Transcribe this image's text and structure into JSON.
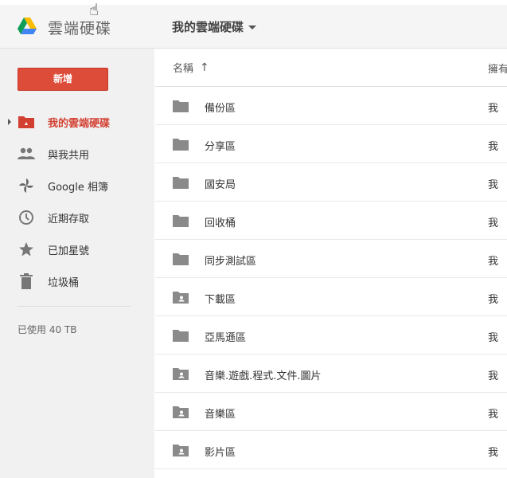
{
  "app": {
    "title": "雲端硬碟"
  },
  "breadcrumb": {
    "current": "我的雲端硬碟"
  },
  "sidebar": {
    "new_button": "新增",
    "items": [
      {
        "label": "我的雲端硬碟",
        "icon": "my-drive-icon",
        "active": true
      },
      {
        "label": "與我共用",
        "icon": "shared-people-icon",
        "active": false
      },
      {
        "label": "Google 相簿",
        "icon": "google-photos-icon",
        "active": false
      },
      {
        "label": "近期存取",
        "icon": "clock-icon",
        "active": false
      },
      {
        "label": "已加星號",
        "icon": "star-icon",
        "active": false
      },
      {
        "label": "垃圾桶",
        "icon": "trash-icon",
        "active": false
      }
    ],
    "storage": "已使用 40 TB"
  },
  "list": {
    "columns": {
      "name": "名稱",
      "owner": "擁有"
    },
    "sort_icon": "arrow-up-icon",
    "rows": [
      {
        "name": "備份區",
        "owner": "我",
        "type": "folder"
      },
      {
        "name": "分享區",
        "owner": "我",
        "type": "folder"
      },
      {
        "name": "國安局",
        "owner": "我",
        "type": "folder"
      },
      {
        "name": "回收桶",
        "owner": "我",
        "type": "folder"
      },
      {
        "name": "同步測試區",
        "owner": "我",
        "type": "folder"
      },
      {
        "name": "下載區",
        "owner": "我",
        "type": "shared-folder"
      },
      {
        "name": "亞馬遜區",
        "owner": "我",
        "type": "folder"
      },
      {
        "name": "音樂.遊戲.程式.文件.圖片",
        "owner": "我",
        "type": "shared-folder"
      },
      {
        "name": "音樂區",
        "owner": "我",
        "type": "shared-folder"
      },
      {
        "name": "影片區",
        "owner": "我",
        "type": "shared-folder"
      }
    ]
  },
  "colors": {
    "accent": "#dd4b39",
    "active_text": "#d23f31",
    "icon_grey": "#8a8a8a"
  }
}
